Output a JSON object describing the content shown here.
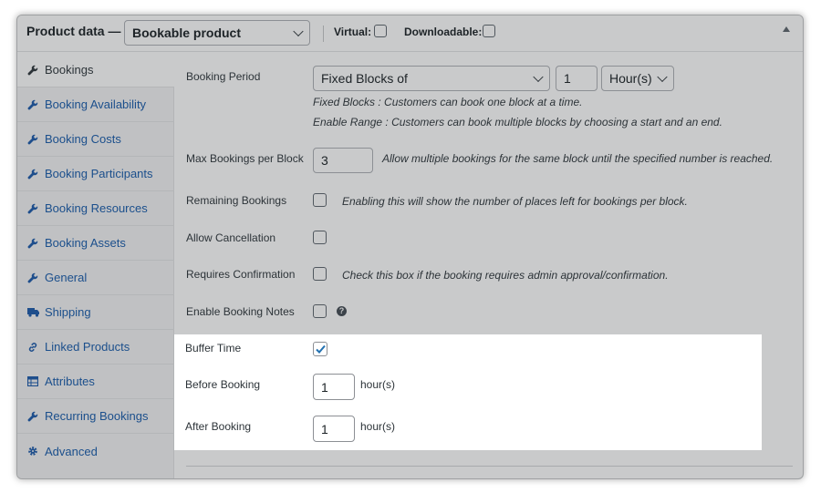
{
  "header": {
    "title": "Product data —",
    "product_type": "Bookable product",
    "virtual_label": "Virtual:",
    "downloadable_label": "Downloadable:"
  },
  "sidebar": {
    "items": [
      {
        "label": "Bookings",
        "icon": "wrench-icon"
      },
      {
        "label": "Booking Availability",
        "icon": "wrench-icon"
      },
      {
        "label": "Booking Costs",
        "icon": "wrench-icon"
      },
      {
        "label": "Booking Participants",
        "icon": "wrench-icon"
      },
      {
        "label": "Booking Resources",
        "icon": "wrench-icon"
      },
      {
        "label": "Booking Assets",
        "icon": "wrench-icon"
      },
      {
        "label": "General",
        "icon": "wrench-icon"
      },
      {
        "label": "Shipping",
        "icon": "truck-icon"
      },
      {
        "label": "Linked Products",
        "icon": "link-icon"
      },
      {
        "label": "Attributes",
        "icon": "table-icon"
      },
      {
        "label": "Recurring Bookings",
        "icon": "wrench-icon"
      },
      {
        "label": "Advanced",
        "icon": "gear-icon"
      }
    ]
  },
  "fields": {
    "booking_period": {
      "label": "Booking Period",
      "mode": "Fixed Blocks of",
      "count": "1",
      "unit": "Hour(s)",
      "desc1": "Fixed Blocks : Customers can book one block at a time.",
      "desc2": "Enable Range : Customers can book multiple blocks by choosing a start and an end."
    },
    "max_bookings": {
      "label": "Max Bookings per Block",
      "value": "3",
      "desc": "Allow multiple bookings for the same block until the specified number is reached."
    },
    "remaining": {
      "label": "Remaining Bookings",
      "desc": "Enabling this will show the number of places left for bookings per block."
    },
    "cancellation": {
      "label": "Allow Cancellation"
    },
    "confirmation": {
      "label": "Requires Confirmation",
      "desc": "Check this box if the booking requires admin approval/confirmation."
    },
    "notes": {
      "label": "Enable Booking Notes"
    },
    "buffer": {
      "label": "Buffer Time",
      "before_label": "Before Booking",
      "before_value": "1",
      "after_label": "After Booking",
      "after_value": "1",
      "unit": "hour(s)"
    }
  }
}
